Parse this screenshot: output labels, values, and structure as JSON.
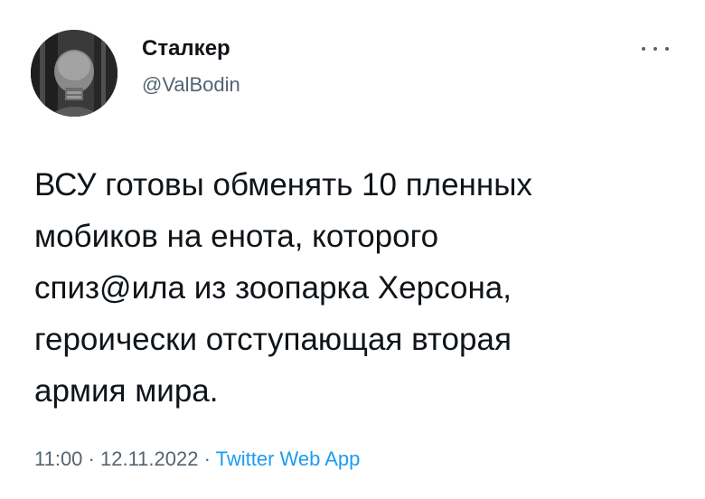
{
  "author": {
    "display_name": "Сталкер",
    "handle": "@ValBodin"
  },
  "icons": {
    "more": "more-horizontal-icon",
    "avatar": "avatar-image"
  },
  "tweet": {
    "lines": [
      "ВСУ готовы обменять 10 пленных",
      "мобиков на енота, которого",
      "спиз@ила из зоопарка Херсона,",
      "героически отступающая вторая",
      "армия мира."
    ]
  },
  "meta": {
    "time": "11:00",
    "separator1": " · ",
    "date": "12.11.2022",
    "separator2": " · ",
    "source": "Twitter Web App"
  },
  "colors": {
    "text": "#0f1419",
    "secondary": "#536471",
    "link": "#1d9bf0",
    "background": "#ffffff"
  }
}
